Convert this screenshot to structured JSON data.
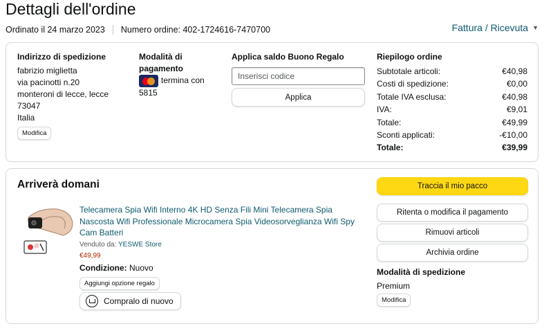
{
  "page": {
    "title": "Dettagli dell'ordine",
    "ordered_on": "Ordinato il 24 marzo 2023",
    "order_number": "Numero ordine: 402-1724616-7470700",
    "invoice_label": "Fattura / Ricevuta"
  },
  "shipping_address": {
    "heading": "Indirizzo di spedizione",
    "lines": [
      "fabrizio miglietta",
      "via pacinotti n.20",
      "monteroni di lecce, lecce",
      "73047",
      "Italia"
    ],
    "edit_label": "Modifica"
  },
  "payment": {
    "heading_line1": "Modalità di",
    "heading_line2": "pagamento",
    "card_text": "termina con",
    "card_digits": "5815"
  },
  "gift_card": {
    "heading": "Applica saldo Buono Regalo",
    "placeholder": "Inserisci codice",
    "apply_label": "Applica"
  },
  "order_summary": {
    "heading": "Riepilogo ordine",
    "rows": [
      {
        "label": "Subtotale articoli:",
        "value": "€40,98"
      },
      {
        "label": "Costi di spedizione:",
        "value": "€0,00"
      },
      {
        "label": "Totale IVA esclusa:",
        "value": "€40,98"
      },
      {
        "label": "IVA:",
        "value": "€9,01"
      },
      {
        "label": "Totale:",
        "value": "€49,99"
      },
      {
        "label": "Sconti applicati:",
        "value": "-€10,00"
      },
      {
        "label": "Totale:",
        "value": "€39,99"
      }
    ]
  },
  "delivery": {
    "heading": "Arriverà domani",
    "product": {
      "title": "Telecamera Spia Wifi Interno 4K HD Senza Fili Mini Telecamera Spia Nascosta Wifi Professionale Microcamera Spia Videosorveglianza Wifi Spy Cam Batteri",
      "seller_prefix": "Venduto da:",
      "seller_name": "YESWE Store",
      "price": "€49,99",
      "condition_label": "Condizione:",
      "condition_value": "Nuovo",
      "gift_option_label": "Aggiungi opzione regalo",
      "buy_again_label": "Compralo di nuovo"
    },
    "actions": {
      "track": "Traccia il mio pacco",
      "retry_payment": "Ritenta o modifica il pagamento",
      "remove": "Rimuovi articoli",
      "archive": "Archivia ordine"
    },
    "shipping_method": {
      "heading": "Modalità di spedizione",
      "value": "Premium",
      "edit_label": "Modifica"
    }
  },
  "colors": {
    "primary_button": "#ffd814",
    "link": "#0f5a6f",
    "price": "#b12704",
    "border": "#d5d9d9"
  }
}
